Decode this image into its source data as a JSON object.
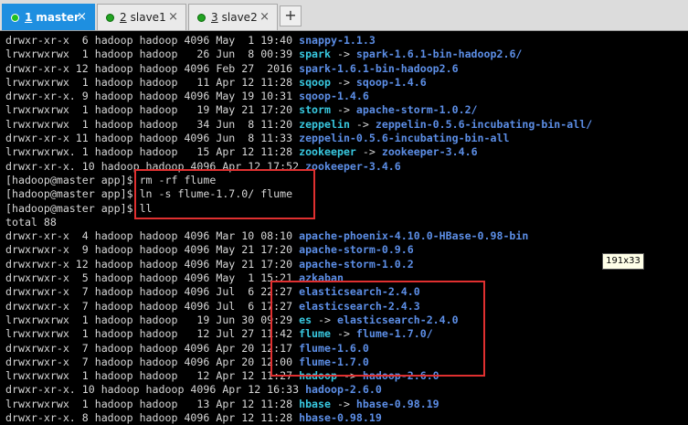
{
  "tabs": [
    {
      "num": "1",
      "label": "master",
      "active": true
    },
    {
      "num": "2",
      "label": "slave1",
      "active": false
    },
    {
      "num": "3",
      "label": "slave2",
      "active": false
    }
  ],
  "add_tab_label": "+",
  "close_glyph": "×",
  "tooltip": "191x33",
  "lines": [
    {
      "meta": "drwxr-xr-x  6 hadoop hadoop 4096 May  1 19:40 ",
      "name": "snappy-1.1.3",
      "type": "dir"
    },
    {
      "meta": "lrwxrwxrwx  1 hadoop hadoop   26 Jun  8 00:39 ",
      "name": "spark",
      "arrow": " -> ",
      "target": "spark-1.6.1-bin-hadoop2.6/",
      "type": "link"
    },
    {
      "meta": "drwxr-xr-x 12 hadoop hadoop 4096 Feb 27  2016 ",
      "name": "spark-1.6.1-bin-hadoop2.6",
      "type": "dir"
    },
    {
      "meta": "lrwxrwxrwx  1 hadoop hadoop   11 Apr 12 11:28 ",
      "name": "sqoop",
      "arrow": " -> ",
      "target": "sqoop-1.4.6",
      "type": "link"
    },
    {
      "meta": "drwxr-xr-x. 9 hadoop hadoop 4096 May 19 10:31 ",
      "name": "sqoop-1.4.6",
      "type": "dir"
    },
    {
      "meta": "lrwxrwxrwx  1 hadoop hadoop   19 May 21 17:20 ",
      "name": "storm",
      "arrow": " -> ",
      "target": "apache-storm-1.0.2/",
      "type": "link"
    },
    {
      "meta": "lrwxrwxrwx  1 hadoop hadoop   34 Jun  8 11:20 ",
      "name": "zeppelin",
      "arrow": " -> ",
      "target": "zeppelin-0.5.6-incubating-bin-all/",
      "type": "link"
    },
    {
      "meta": "drwxr-xr-x 11 hadoop hadoop 4096 Jun  8 11:33 ",
      "name": "zeppelin-0.5.6-incubating-bin-all",
      "type": "dir"
    },
    {
      "meta": "lrwxrwxrwx. 1 hadoop hadoop   15 Apr 12 11:28 ",
      "name": "zookeeper",
      "arrow": " -> ",
      "target": "zookeeper-3.4.6",
      "type": "link"
    },
    {
      "meta": "drwxr-xr-x. 10 hadoop hadoop 4096 Apr 12 17:52 ",
      "name": "zookeeper-3.4.6",
      "type": "dir"
    },
    {
      "meta": "[hadoop@master app]$ rm -rf flume",
      "type": "plain"
    },
    {
      "meta": "[hadoop@master app]$ ln -s flume-1.7.0/ flume",
      "type": "plain"
    },
    {
      "meta": "[hadoop@master app]$ ll",
      "type": "plain"
    },
    {
      "meta": "total 88",
      "type": "plain"
    },
    {
      "meta": "drwxr-xr-x  4 hadoop hadoop 4096 Mar 10 08:10 ",
      "name": "apache-phoenix-4.10.0-HBase-0.98-bin",
      "type": "dir"
    },
    {
      "meta": "drwxrwxr-x  9 hadoop hadoop 4096 May 21 17:20 ",
      "name": "apache-storm-0.9.6",
      "type": "dir"
    },
    {
      "meta": "drwxrwxr-x 12 hadoop hadoop 4096 May 21 17:20 ",
      "name": "apache-storm-1.0.2",
      "type": "dir"
    },
    {
      "meta": "drwxrwxr-x  5 hadoop hadoop 4096 May  1 15:21 ",
      "name": "azkaban",
      "type": "dir"
    },
    {
      "meta": "drwxrwxr-x  7 hadoop hadoop 4096 Jul  6 22:27 ",
      "name": "elasticsearch-2.4.0",
      "type": "dir"
    },
    {
      "meta": "drwxrwxr-x  7 hadoop hadoop 4096 Jul  6 17:27 ",
      "name": "elasticsearch-2.4.3",
      "type": "dir"
    },
    {
      "meta": "lrwxrwxrwx  1 hadoop hadoop   19 Jun 30 09:29 ",
      "name": "es",
      "arrow": " -> ",
      "target": "elasticsearch-2.4.0",
      "type": "link"
    },
    {
      "meta": "lrwxrwxrwx  1 hadoop hadoop   12 Jul 27 11:42 ",
      "name": "flume",
      "arrow": " -> ",
      "target": "flume-1.7.0/",
      "type": "link"
    },
    {
      "meta": "drwxrwxr-x  7 hadoop hadoop 4096 Apr 20 12:17 ",
      "name": "flume-1.6.0",
      "type": "dir"
    },
    {
      "meta": "drwxrwxr-x  7 hadoop hadoop 4096 Apr 20 12:00 ",
      "name": "flume-1.7.0",
      "type": "dir"
    },
    {
      "meta": "lrwxrwxrwx  1 hadoop hadoop   12 Apr 12 11:27 ",
      "name": "hadoop",
      "arrow": " -> ",
      "target": "hadoop-2.6.0",
      "type": "link"
    },
    {
      "meta": "drwxr-xr-x. 10 hadoop hadoop 4096 Apr 12 16:33 ",
      "name": "hadoop-2.6.0",
      "type": "dir"
    },
    {
      "meta": "lrwxrwxrwx  1 hadoop hadoop   13 Apr 12 11:28 ",
      "name": "hbase",
      "arrow": " -> ",
      "target": "hbase-0.98.19",
      "type": "link"
    },
    {
      "meta": "drwxr-xr-x. 8 hadoop hadoop 4096 Apr 12 11:28 ",
      "name": "hbase-0.98.19",
      "type": "dir"
    }
  ]
}
